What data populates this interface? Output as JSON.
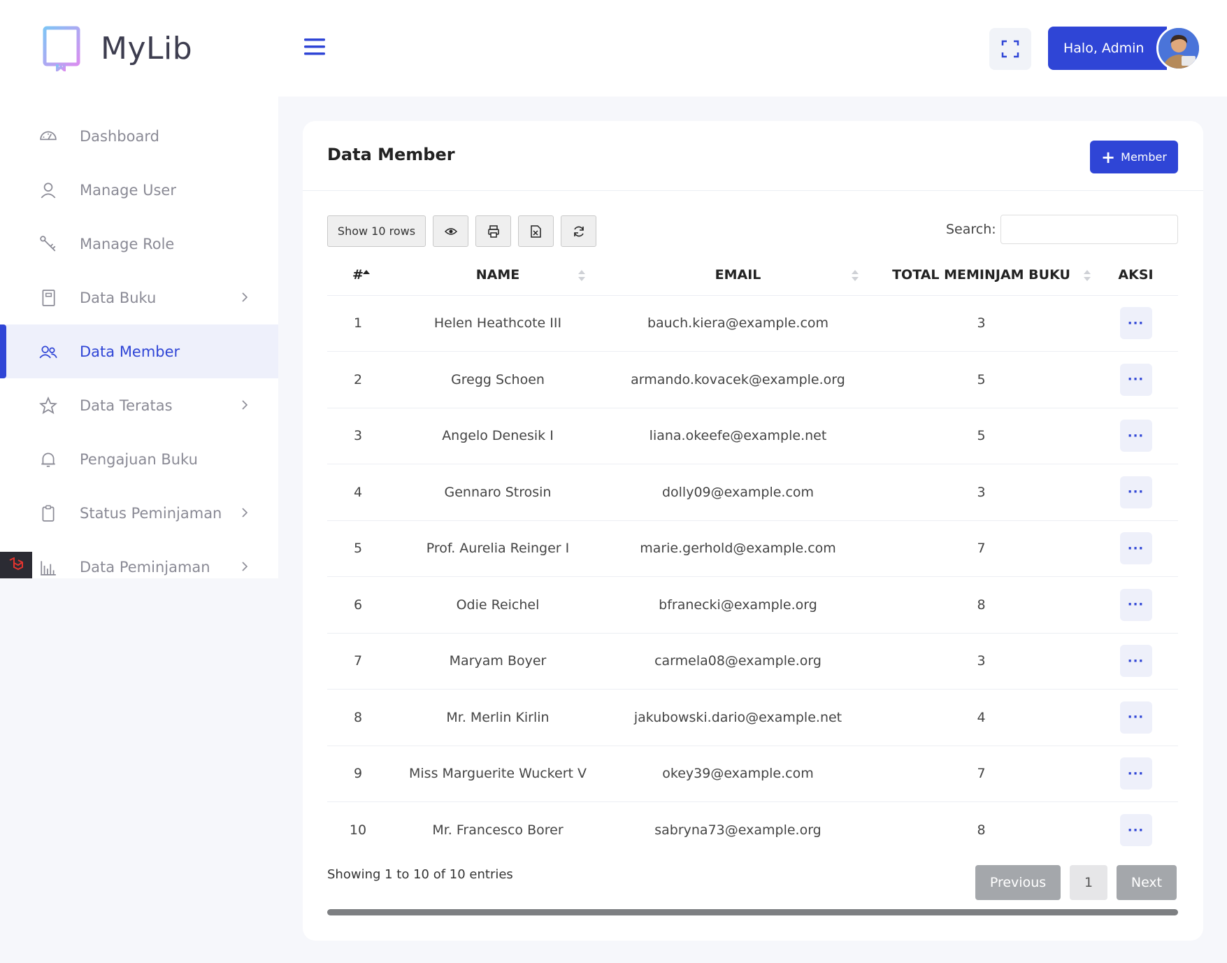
{
  "app": {
    "name": "MyLib"
  },
  "colors": {
    "primary": "#2f45d6",
    "active_bg": "#eef0fb",
    "muted": "#8a8a95"
  },
  "sidebar": {
    "items": [
      {
        "label": "Dashboard",
        "icon": "gauge-icon",
        "has_submenu": false,
        "active": false
      },
      {
        "label": "Manage User",
        "icon": "user-icon",
        "has_submenu": false,
        "active": false
      },
      {
        "label": "Manage Role",
        "icon": "key-icon",
        "has_submenu": false,
        "active": false
      },
      {
        "label": "Data Buku",
        "icon": "book-icon",
        "has_submenu": true,
        "active": false
      },
      {
        "label": "Data Member",
        "icon": "users-icon",
        "has_submenu": false,
        "active": true
      },
      {
        "label": "Data Teratas",
        "icon": "star-icon",
        "has_submenu": true,
        "active": false
      },
      {
        "label": "Pengajuan Buku",
        "icon": "bell-icon",
        "has_submenu": false,
        "active": false
      },
      {
        "label": "Status Peminjaman",
        "icon": "clipboard-icon",
        "has_submenu": true,
        "active": false
      },
      {
        "label": "Data Peminjaman",
        "icon": "bar-chart-icon",
        "has_submenu": true,
        "active": false
      }
    ]
  },
  "header": {
    "user_greeting": "Halo, Admin"
  },
  "card": {
    "title": "Data Member",
    "add_button": "Member",
    "show_rows": "Show 10 rows",
    "search_label": "Search:",
    "search_value": ""
  },
  "table": {
    "columns": [
      "#",
      "NAME",
      "EMAIL",
      "TOTAL MEMINJAM BUKU",
      "AKSI"
    ],
    "rows": [
      {
        "no": "1",
        "name": "Helen Heathcote III",
        "email": "bauch.kiera@example.com",
        "total": "3"
      },
      {
        "no": "2",
        "name": "Gregg Schoen",
        "email": "armando.kovacek@example.org",
        "total": "5"
      },
      {
        "no": "3",
        "name": "Angelo Denesik I",
        "email": "liana.okeefe@example.net",
        "total": "5"
      },
      {
        "no": "4",
        "name": "Gennaro Strosin",
        "email": "dolly09@example.com",
        "total": "3"
      },
      {
        "no": "5",
        "name": "Prof. Aurelia Reinger I",
        "email": "marie.gerhold@example.com",
        "total": "7"
      },
      {
        "no": "6",
        "name": "Odie Reichel",
        "email": "bfranecki@example.org",
        "total": "8"
      },
      {
        "no": "7",
        "name": "Maryam Boyer",
        "email": "carmela08@example.org",
        "total": "3"
      },
      {
        "no": "8",
        "name": "Mr. Merlin Kirlin",
        "email": "jakubowski.dario@example.net",
        "total": "4"
      },
      {
        "no": "9",
        "name": "Miss Marguerite Wuckert V",
        "email": "okey39@example.com",
        "total": "7"
      },
      {
        "no": "10",
        "name": "Mr. Francesco Borer",
        "email": "sabryna73@example.org",
        "total": "8"
      }
    ],
    "action_label": "···"
  },
  "pagination": {
    "info": "Showing 1 to 10 of 10 entries",
    "previous": "Previous",
    "page": "1",
    "next": "Next"
  }
}
